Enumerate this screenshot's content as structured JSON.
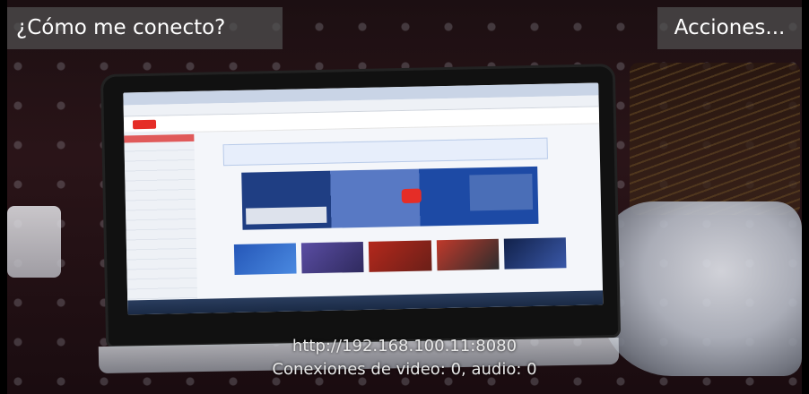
{
  "overlay": {
    "connect_button": "¿Cómo me conecto?",
    "actions_button": "Acciones..."
  },
  "status": {
    "server_url": "http://192.168.100.11:8080",
    "connections": "Conexiones de video: 0, audio: 0"
  },
  "colors": {
    "button_bg": "#505050",
    "text": "#ffffff"
  }
}
